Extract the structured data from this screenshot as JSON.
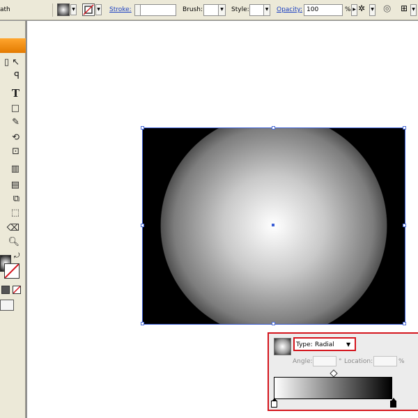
{
  "control_bar": {
    "path_label": "ath",
    "stroke_label": "Stroke:",
    "brush_label": "Brush:",
    "style_label": "Style:",
    "opacity_label": "Opacity:",
    "opacity_value": "100",
    "opacity_unit": "%"
  },
  "gradient_panel": {
    "type_label": "Type:",
    "type_value": "Radial",
    "angle_label": "Angle:",
    "degree_symbol": "°",
    "location_label": "Location:",
    "percent_symbol": "%",
    "stops": [
      {
        "color": "#ffffff",
        "location": 0
      },
      {
        "color": "#000000",
        "location": 100
      }
    ]
  },
  "artwork": {
    "fill": "radial-gradient",
    "center_color": "#ffffff",
    "edge_color": "#000000",
    "selection_color": "#3c5fd6"
  },
  "tools": [
    "direct-selection",
    "lasso",
    "type",
    "rectangle",
    "pencil",
    "rotate",
    "free-transform",
    "column-graph",
    "gradient",
    "blend",
    "slice",
    "eraser",
    "zoom"
  ],
  "highlight_color": "#d4141c"
}
